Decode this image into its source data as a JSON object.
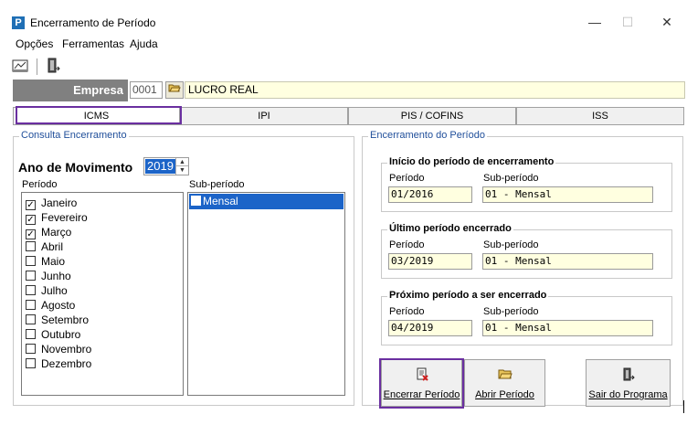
{
  "window": {
    "app_icon": "P",
    "title": "Encerramento de Período",
    "minimize": "—",
    "maximize": "☐",
    "close": "✕"
  },
  "menu": [
    "Opções",
    "Ferramentas",
    "Ajuda"
  ],
  "toolbar": {
    "icons": [
      "report-icon",
      "exit-door-icon"
    ]
  },
  "empresa": {
    "label": "Empresa",
    "code": "0001",
    "name": "LUCRO REAL"
  },
  "tabs": [
    {
      "label": "ICMS",
      "active": true
    },
    {
      "label": "IPI",
      "active": false
    },
    {
      "label": "PIS / COFINS",
      "active": false
    },
    {
      "label": "ISS",
      "active": false
    }
  ],
  "consulta": {
    "title": "Consulta Encerramento",
    "ano_label": "Ano de Movimento",
    "ano_value": "2019",
    "periodo_label": "Período",
    "subperiodo_label": "Sub-período",
    "months": [
      {
        "label": "Janeiro",
        "checked": true
      },
      {
        "label": "Fevereiro",
        "checked": true
      },
      {
        "label": "Março",
        "checked": true
      },
      {
        "label": "Abril",
        "checked": false
      },
      {
        "label": "Maio",
        "checked": false
      },
      {
        "label": "Junho",
        "checked": false
      },
      {
        "label": "Julho",
        "checked": false
      },
      {
        "label": "Agosto",
        "checked": false
      },
      {
        "label": "Setembro",
        "checked": false
      },
      {
        "label": "Outubro",
        "checked": false
      },
      {
        "label": "Novembro",
        "checked": false
      },
      {
        "label": "Dezembro",
        "checked": false
      }
    ],
    "subperiods": [
      {
        "label": "Mensal",
        "checked": false,
        "selected": true
      }
    ]
  },
  "encerramento": {
    "title": "Encerramento do Período",
    "inicio": {
      "title": "Início do período de encerramento",
      "periodo_label": "Período",
      "subperiodo_label": "Sub-período",
      "periodo": "01/2016",
      "subperiodo": "01 - Mensal"
    },
    "ultimo": {
      "title": "Último período encerrado",
      "periodo_label": "Período",
      "subperiodo_label": "Sub-período",
      "periodo": "03/2019",
      "subperiodo": "01 - Mensal"
    },
    "proximo": {
      "title": "Próximo período a ser encerrado",
      "periodo_label": "Período",
      "subperiodo_label": "Sub-período",
      "periodo": "04/2019",
      "subperiodo": "01 - Mensal"
    }
  },
  "buttons": {
    "encerrar": "Encerrar Período",
    "abrir": "Abrir Período",
    "sair": "Sair do Programa"
  }
}
